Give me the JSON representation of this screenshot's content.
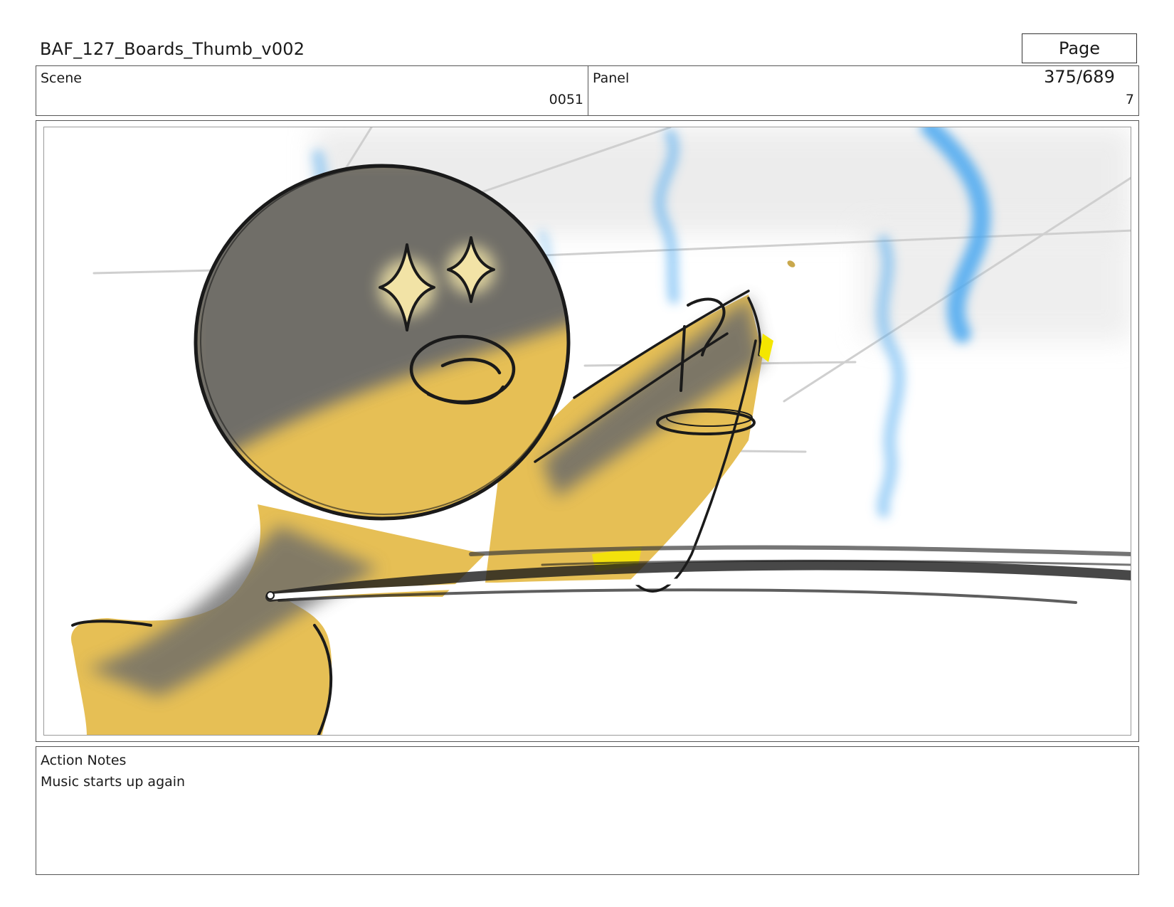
{
  "document": {
    "title": "BAF_127_Boards_Thumb_v002",
    "page_counter": "Page 375/689"
  },
  "header": {
    "scene_label": "Scene",
    "scene_value": "0051",
    "panel_label": "Panel",
    "panel_value": "7"
  },
  "notes": {
    "label": "Action Notes",
    "text": "Music starts up again"
  },
  "colors": {
    "character_fill": "#e6bf55",
    "shadow": "#6b6b6b",
    "ink": "#1a1a1a",
    "steam_blue": "#4aa8f0",
    "highlight_yellow": "#f4e600"
  }
}
